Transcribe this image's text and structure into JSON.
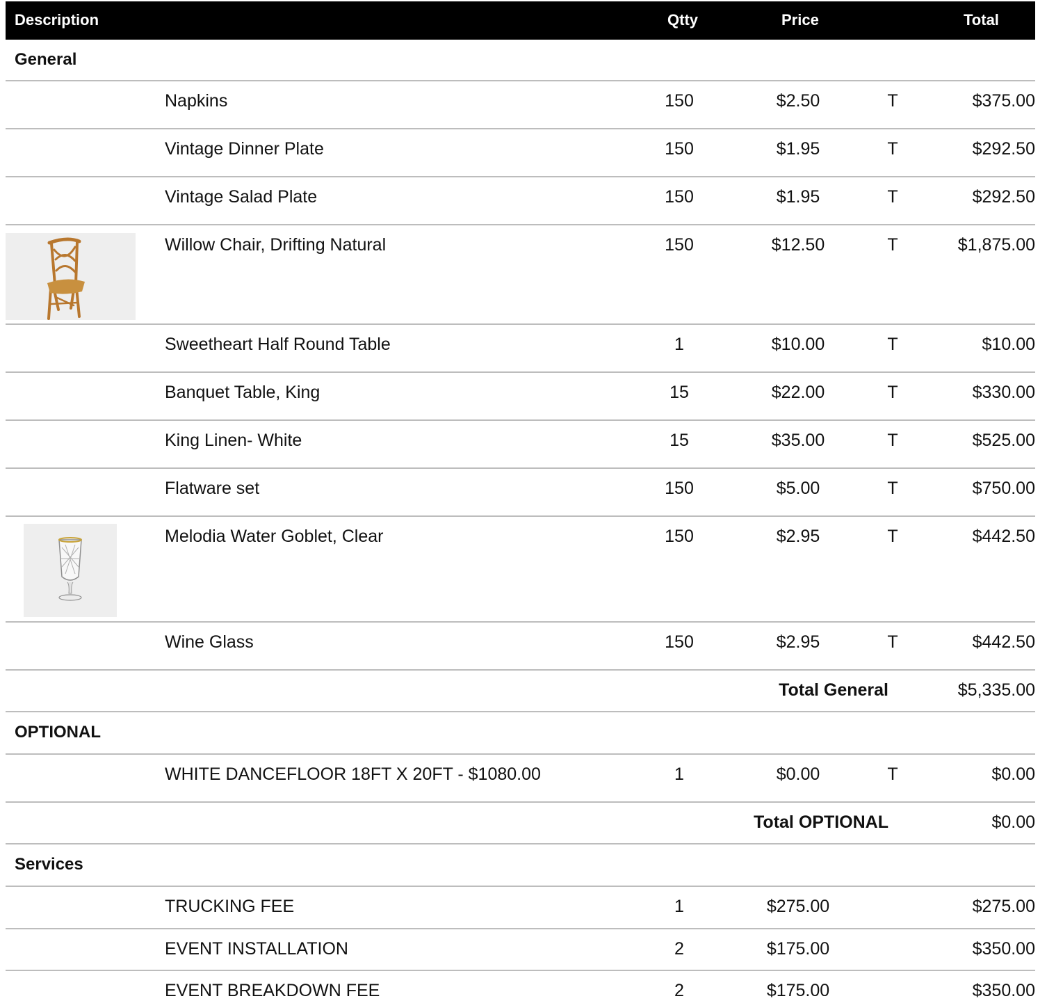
{
  "columns": {
    "description": "Description",
    "qty": "Qtty",
    "price": "Price",
    "total": "Total"
  },
  "sections": [
    {
      "name": "General",
      "items": [
        {
          "description": "Napkins",
          "qty": "150",
          "price": "$2.50",
          "tax": "T",
          "total": "$375.00"
        },
        {
          "description": "Vintage Dinner Plate",
          "qty": "150",
          "price": "$1.95",
          "tax": "T",
          "total": "$292.50"
        },
        {
          "description": "Vintage Salad Plate",
          "qty": "150",
          "price": "$1.95",
          "tax": "T",
          "total": "$292.50"
        },
        {
          "description": "Willow Chair, Drifting Natural",
          "qty": "150",
          "price": "$12.50",
          "tax": "T",
          "total": "$1,875.00",
          "image": "wooden-chair-photo"
        },
        {
          "description": "Sweetheart Half Round Table",
          "qty": "1",
          "price": "$10.00",
          "tax": "T",
          "total": "$10.00"
        },
        {
          "description": "Banquet Table, King",
          "qty": "15",
          "price": "$22.00",
          "tax": "T",
          "total": "$330.00"
        },
        {
          "description": "King Linen- White",
          "qty": "15",
          "price": "$35.00",
          "tax": "T",
          "total": "$525.00"
        },
        {
          "description": "Flatware set",
          "qty": "150",
          "price": "$5.00",
          "tax": "T",
          "total": "$750.00"
        },
        {
          "description": "Melodia Water Goblet, Clear",
          "qty": "150",
          "price": "$2.95",
          "tax": "T",
          "total": "$442.50",
          "image": "crystal-goblet-photo"
        },
        {
          "description": "Wine Glass",
          "qty": "150",
          "price": "$2.95",
          "tax": "T",
          "total": "$442.50"
        }
      ],
      "subtotal": {
        "label": "Total General",
        "value": "$5,335.00"
      }
    },
    {
      "name": "OPTIONAL",
      "items": [
        {
          "description": "WHITE DANCEFLOOR 18FT X 20FT - $1080.00",
          "qty": "1",
          "price": "$0.00",
          "tax": "T",
          "total": "$0.00"
        }
      ],
      "subtotal": {
        "label": "Total OPTIONAL",
        "value": "$0.00"
      }
    },
    {
      "name": "Services",
      "items": [
        {
          "description": "TRUCKING FEE",
          "qty": "1",
          "price": "$275.00",
          "tax": "",
          "total": "$275.00"
        },
        {
          "description": "EVENT INSTALLATION",
          "qty": "2",
          "price": "$175.00",
          "tax": "",
          "total": "$350.00"
        },
        {
          "description": "EVENT BREAKDOWN FEE",
          "qty": "2",
          "price": "$175.00",
          "tax": "",
          "total": "$350.00"
        }
      ]
    }
  ]
}
